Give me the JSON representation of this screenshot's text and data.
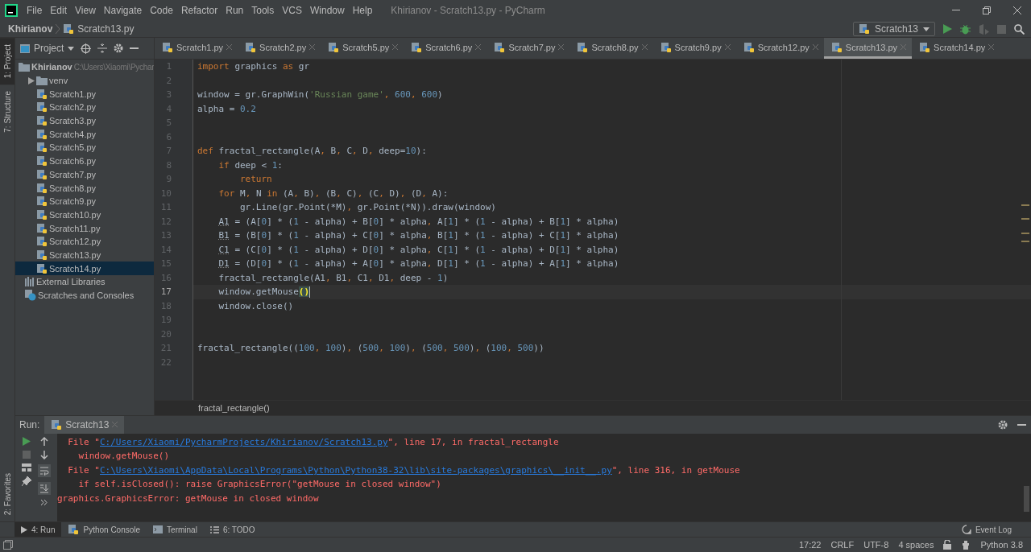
{
  "window": {
    "title": "Khirianov - Scratch13.py - PyCharm"
  },
  "menu": [
    "File",
    "Edit",
    "View",
    "Navigate",
    "Code",
    "Refactor",
    "Run",
    "Tools",
    "VCS",
    "Window",
    "Help"
  ],
  "navbar": {
    "project": "Khirianov",
    "file": "Scratch13.py",
    "run_config": "Scratch13"
  },
  "stripe_top": [
    {
      "label": "1: Project",
      "selected": true
    },
    {
      "label": "7: Structure",
      "selected": false
    }
  ],
  "stripe_bottom": [
    {
      "label": "2: Favorites",
      "selected": false
    }
  ],
  "project_panel": {
    "title": "Project",
    "tree": [
      {
        "kind": "folder",
        "name": "Khirianov",
        "path": "C:\\Users\\Xiaomi\\Pychar",
        "expanded": true,
        "selected": false,
        "children": [
          {
            "kind": "folder",
            "name": "venv",
            "expanded": false,
            "selected": false
          },
          {
            "kind": "py",
            "name": "Scratch1.py",
            "selected": false
          },
          {
            "kind": "py",
            "name": "Scratch2.py",
            "selected": false
          },
          {
            "kind": "py",
            "name": "Scratch3.py",
            "selected": false
          },
          {
            "kind": "py",
            "name": "Scratch4.py",
            "selected": false
          },
          {
            "kind": "py",
            "name": "Scratch5.py",
            "selected": false
          },
          {
            "kind": "py",
            "name": "Scratch6.py",
            "selected": false
          },
          {
            "kind": "py",
            "name": "Scratch7.py",
            "selected": false
          },
          {
            "kind": "py",
            "name": "Scratch8.py",
            "selected": false
          },
          {
            "kind": "py",
            "name": "Scratch9.py",
            "selected": false
          },
          {
            "kind": "py",
            "name": "Scratch10.py",
            "selected": false
          },
          {
            "kind": "py",
            "name": "Scratch11.py",
            "selected": false
          },
          {
            "kind": "py",
            "name": "Scratch12.py",
            "selected": false
          },
          {
            "kind": "py",
            "name": "Scratch13.py",
            "selected": false
          },
          {
            "kind": "py",
            "name": "Scratch14.py",
            "selected": true
          }
        ]
      },
      {
        "kind": "libraries",
        "name": "External Libraries",
        "selected": false
      },
      {
        "kind": "scratches",
        "name": "Scratches and Consoles",
        "selected": false
      }
    ]
  },
  "editor": {
    "tabs": [
      {
        "label": "Scratch1.py",
        "selected": false
      },
      {
        "label": "Scratch2.py",
        "selected": false
      },
      {
        "label": "Scratch5.py",
        "selected": false
      },
      {
        "label": "Scratch6.py",
        "selected": false
      },
      {
        "label": "Scratch7.py",
        "selected": false
      },
      {
        "label": "Scratch8.py",
        "selected": false
      },
      {
        "label": "Scratch9.py",
        "selected": false
      },
      {
        "label": "Scratch12.py",
        "selected": false
      },
      {
        "label": "Scratch13.py",
        "selected": true
      },
      {
        "label": "Scratch14.py",
        "selected": false
      }
    ],
    "lines": [
      {
        "n": "1",
        "current": false,
        "tokens": [
          {
            "kind": "kw",
            "text": "import"
          },
          {
            "kind": "p",
            "text": " graphics "
          },
          {
            "kind": "kw",
            "text": "as"
          },
          {
            "kind": "p",
            "text": " gr"
          }
        ]
      },
      {
        "n": "2",
        "current": false
      },
      {
        "n": "3",
        "current": false,
        "tokens": [
          {
            "kind": "p",
            "text": "window = gr.GraphWin("
          },
          {
            "kind": "str",
            "text": "'Russian game'"
          },
          {
            "kind": "kw",
            "text": ","
          },
          {
            "kind": "num",
            "text": " 600"
          },
          {
            "kind": "kw",
            "text": ","
          },
          {
            "kind": "num",
            "text": " 600"
          },
          {
            "kind": "p",
            "text": ")"
          }
        ]
      },
      {
        "n": "4",
        "current": false,
        "tokens": [
          {
            "kind": "p",
            "text": "alpha = "
          },
          {
            "kind": "num",
            "text": "0.2"
          }
        ]
      },
      {
        "n": "5",
        "current": false
      },
      {
        "n": "6",
        "current": false
      },
      {
        "n": "7",
        "current": false,
        "tokens": [
          {
            "kind": "kw",
            "text": "def"
          },
          {
            "kind": "p",
            "text": " fractal_rectangle(A"
          },
          {
            "kind": "kw",
            "text": ","
          },
          {
            "kind": "p",
            "text": " B"
          },
          {
            "kind": "kw",
            "text": ","
          },
          {
            "kind": "p",
            "text": " C"
          },
          {
            "kind": "kw",
            "text": ","
          },
          {
            "kind": "p",
            "text": " D"
          },
          {
            "kind": "kw",
            "text": ","
          },
          {
            "kind": "p",
            "text": " deep="
          },
          {
            "kind": "num",
            "text": "10"
          },
          {
            "kind": "p",
            "text": "):"
          }
        ]
      },
      {
        "n": "8",
        "current": false,
        "tokens": [
          {
            "kind": "kw",
            "text": "    if"
          },
          {
            "kind": "p",
            "text": " deep < "
          },
          {
            "kind": "num",
            "text": "1"
          },
          {
            "kind": "p",
            "text": ":"
          }
        ]
      },
      {
        "n": "9",
        "current": false,
        "tokens": [
          {
            "kind": "kw",
            "text": "        return"
          }
        ]
      },
      {
        "n": "10",
        "current": false,
        "tokens": [
          {
            "kind": "kw",
            "text": "    for"
          },
          {
            "kind": "p",
            "text": " M"
          },
          {
            "kind": "kw",
            "text": ","
          },
          {
            "kind": "p",
            "text": " N "
          },
          {
            "kind": "kw",
            "text": "in"
          },
          {
            "kind": "p",
            "text": " (A"
          },
          {
            "kind": "kw",
            "text": ","
          },
          {
            "kind": "p",
            "text": " B)"
          },
          {
            "kind": "kw",
            "text": ","
          },
          {
            "kind": "p",
            "text": " (B"
          },
          {
            "kind": "kw",
            "text": ","
          },
          {
            "kind": "p",
            "text": " C)"
          },
          {
            "kind": "kw",
            "text": ","
          },
          {
            "kind": "p",
            "text": " (C"
          },
          {
            "kind": "kw",
            "text": ","
          },
          {
            "kind": "p",
            "text": " D)"
          },
          {
            "kind": "kw",
            "text": ","
          },
          {
            "kind": "p",
            "text": " (D"
          },
          {
            "kind": "kw",
            "text": ","
          },
          {
            "kind": "p",
            "text": " A):"
          }
        ]
      },
      {
        "n": "11",
        "current": false,
        "tokens": [
          {
            "kind": "p",
            "text": "        gr.Line(gr.Point(*M)"
          },
          {
            "kind": "kw",
            "text": ","
          },
          {
            "kind": "p",
            "text": " gr.Point(*N)).draw(window)"
          }
        ]
      },
      {
        "n": "12",
        "current": false,
        "tokens": [
          {
            "kind": "warn",
            "text": "    A1"
          },
          {
            "kind": "p",
            "text": " = (A["
          },
          {
            "kind": "num",
            "text": "0"
          },
          {
            "kind": "p",
            "text": "] * ("
          },
          {
            "kind": "num",
            "text": "1"
          },
          {
            "kind": "p",
            "text": " - alpha) + B["
          },
          {
            "kind": "num",
            "text": "0"
          },
          {
            "kind": "p",
            "text": "] * alpha"
          },
          {
            "kind": "kw",
            "text": ","
          },
          {
            "kind": "p",
            "text": " A["
          },
          {
            "kind": "num",
            "text": "1"
          },
          {
            "kind": "p",
            "text": "] * ("
          },
          {
            "kind": "num",
            "text": "1"
          },
          {
            "kind": "p",
            "text": " - alpha) + B["
          },
          {
            "kind": "num",
            "text": "1"
          },
          {
            "kind": "p",
            "text": "] * alpha)"
          }
        ]
      },
      {
        "n": "13",
        "current": false,
        "tokens": [
          {
            "kind": "warn",
            "text": "    B1"
          },
          {
            "kind": "p",
            "text": " = (B["
          },
          {
            "kind": "num",
            "text": "0"
          },
          {
            "kind": "p",
            "text": "] * ("
          },
          {
            "kind": "num",
            "text": "1"
          },
          {
            "kind": "p",
            "text": " - alpha) + C["
          },
          {
            "kind": "num",
            "text": "0"
          },
          {
            "kind": "p",
            "text": "] * alpha"
          },
          {
            "kind": "kw",
            "text": ","
          },
          {
            "kind": "p",
            "text": " B["
          },
          {
            "kind": "num",
            "text": "1"
          },
          {
            "kind": "p",
            "text": "] * ("
          },
          {
            "kind": "num",
            "text": "1"
          },
          {
            "kind": "p",
            "text": " - alpha) + C["
          },
          {
            "kind": "num",
            "text": "1"
          },
          {
            "kind": "p",
            "text": "] * alpha)"
          }
        ]
      },
      {
        "n": "14",
        "current": false,
        "tokens": [
          {
            "kind": "warn",
            "text": "    C1"
          },
          {
            "kind": "p",
            "text": " = (C["
          },
          {
            "kind": "num",
            "text": "0"
          },
          {
            "kind": "p",
            "text": "] * ("
          },
          {
            "kind": "num",
            "text": "1"
          },
          {
            "kind": "p",
            "text": " - alpha) + D["
          },
          {
            "kind": "num",
            "text": "0"
          },
          {
            "kind": "p",
            "text": "] * alpha"
          },
          {
            "kind": "kw",
            "text": ","
          },
          {
            "kind": "p",
            "text": " C["
          },
          {
            "kind": "num",
            "text": "1"
          },
          {
            "kind": "p",
            "text": "] * ("
          },
          {
            "kind": "num",
            "text": "1"
          },
          {
            "kind": "p",
            "text": " - alpha) + D["
          },
          {
            "kind": "num",
            "text": "1"
          },
          {
            "kind": "p",
            "text": "] * alpha)"
          }
        ]
      },
      {
        "n": "15",
        "current": false,
        "tokens": [
          {
            "kind": "warn",
            "text": "    D1"
          },
          {
            "kind": "p",
            "text": " = (D["
          },
          {
            "kind": "num",
            "text": "0"
          },
          {
            "kind": "p",
            "text": "] * ("
          },
          {
            "kind": "num",
            "text": "1"
          },
          {
            "kind": "p",
            "text": " - alpha) + A["
          },
          {
            "kind": "num",
            "text": "0"
          },
          {
            "kind": "p",
            "text": "] * alpha"
          },
          {
            "kind": "kw",
            "text": ","
          },
          {
            "kind": "p",
            "text": " D["
          },
          {
            "kind": "num",
            "text": "1"
          },
          {
            "kind": "p",
            "text": "] * ("
          },
          {
            "kind": "num",
            "text": "1"
          },
          {
            "kind": "p",
            "text": " - alpha) + A["
          },
          {
            "kind": "num",
            "text": "1"
          },
          {
            "kind": "p",
            "text": "] * alpha)"
          }
        ]
      },
      {
        "n": "16",
        "current": false,
        "tokens": [
          {
            "kind": "p",
            "text": "    fractal_rectangle(A1"
          },
          {
            "kind": "kw",
            "text": ","
          },
          {
            "kind": "p",
            "text": " B1"
          },
          {
            "kind": "kw",
            "text": ","
          },
          {
            "kind": "p",
            "text": " C1"
          },
          {
            "kind": "kw",
            "text": ","
          },
          {
            "kind": "p",
            "text": " D1"
          },
          {
            "kind": "kw",
            "text": ","
          },
          {
            "kind": "p",
            "text": " deep - "
          },
          {
            "kind": "num",
            "text": "1"
          },
          {
            "kind": "p",
            "text": ")"
          }
        ]
      },
      {
        "n": "17",
        "current": true,
        "tokens": [
          {
            "kind": "p",
            "text": "    window.getMouse"
          },
          {
            "kind": "match",
            "text": "()"
          }
        ]
      },
      {
        "n": "18",
        "current": false,
        "tokens": [
          {
            "kind": "p",
            "text": "    window.close()"
          }
        ]
      },
      {
        "n": "19",
        "current": false
      },
      {
        "n": "20",
        "current": false
      },
      {
        "n": "21",
        "current": false,
        "tokens": [
          {
            "kind": "p",
            "text": "fractal_rectangle(("
          },
          {
            "kind": "num",
            "text": "100"
          },
          {
            "kind": "kw",
            "text": ","
          },
          {
            "kind": "num",
            "text": " 100"
          },
          {
            "kind": "p",
            "text": ")"
          },
          {
            "kind": "kw",
            "text": ","
          },
          {
            "kind": "p",
            "text": " ("
          },
          {
            "kind": "num",
            "text": "500"
          },
          {
            "kind": "kw",
            "text": ","
          },
          {
            "kind": "num",
            "text": " 100"
          },
          {
            "kind": "p",
            "text": ")"
          },
          {
            "kind": "kw",
            "text": ","
          },
          {
            "kind": "p",
            "text": " ("
          },
          {
            "kind": "num",
            "text": "500"
          },
          {
            "kind": "kw",
            "text": ","
          },
          {
            "kind": "num",
            "text": " 500"
          },
          {
            "kind": "p",
            "text": ")"
          },
          {
            "kind": "kw",
            "text": ","
          },
          {
            "kind": "p",
            "text": " ("
          },
          {
            "kind": "num",
            "text": "100"
          },
          {
            "kind": "kw",
            "text": ","
          },
          {
            "kind": "num",
            "text": " 500"
          },
          {
            "kind": "p",
            "text": "))"
          }
        ]
      },
      {
        "n": "22",
        "current": false
      }
    ],
    "breadcrumb": "fractal_rectangle()"
  },
  "run_panel": {
    "label": "Run:",
    "tab": "Scratch13",
    "console": [
      {
        "segments": [
          {
            "kind": "error",
            "text": "  File \""
          },
          {
            "kind": "link",
            "text": "C:/Users/Xiaomi/PycharmProjects/Khirianov/Scratch13.py"
          },
          {
            "kind": "error",
            "text": "\", line 17, in fractal_rectangle"
          }
        ]
      },
      {
        "segments": [
          {
            "kind": "error",
            "text": "    window.getMouse()"
          }
        ]
      },
      {
        "segments": [
          {
            "kind": "error",
            "text": "  File \""
          },
          {
            "kind": "link",
            "text": "C:\\Users\\Xiaomi\\AppData\\Local\\Programs\\Python\\Python38-32\\lib\\site-packages\\graphics\\__init__.py"
          },
          {
            "kind": "error",
            "text": "\", line 316, in getMouse"
          }
        ]
      },
      {
        "segments": [
          {
            "kind": "error",
            "text": "    if self.isClosed(): raise GraphicsError(\"getMouse in closed window\")"
          }
        ]
      },
      {
        "segments": [
          {
            "kind": "error",
            "text": "graphics.GraphicsError: getMouse in closed window"
          }
        ]
      }
    ]
  },
  "tool_tabs": [
    {
      "kind": "run",
      "label": "4: Run",
      "selected": true
    },
    {
      "kind": "console",
      "label": "Python Console",
      "selected": false
    },
    {
      "kind": "terminal",
      "label": "Terminal",
      "selected": false
    },
    {
      "kind": "todo",
      "label": "6: TODO",
      "selected": false
    }
  ],
  "event_log": "Event Log",
  "status_bar": {
    "items": [
      "17:22",
      "CRLF",
      "UTF-8",
      "4 spaces"
    ],
    "interpreter": "Python 3.8"
  }
}
